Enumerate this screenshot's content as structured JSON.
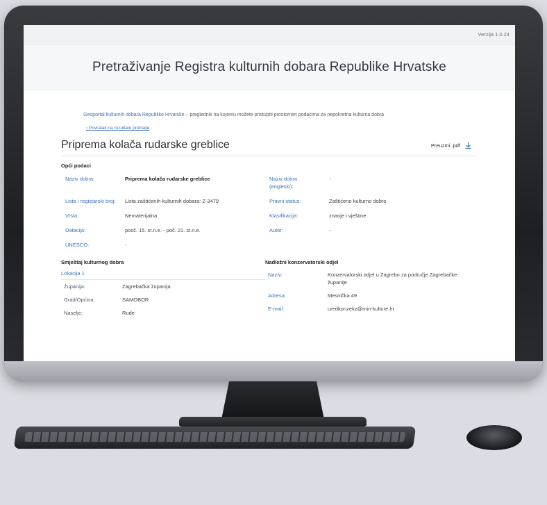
{
  "app": {
    "version": "Verzija 1.0.24",
    "title": "Pretraživanje Registra kulturnih dobara Republike Hrvatske"
  },
  "intro": {
    "link_text": "Geoportal kulturnih dobara Republike Hrvatske",
    "text": " – preglednik na kojemu možete pristupiti prostornim podacima za nepokretna kulturna dobra",
    "back_link": "‹ Povratak na rezultate pretrage"
  },
  "record": {
    "title": "Priprema kolača rudarske greblice",
    "pdf_label": "Preuzmi .pdf",
    "section_general": "Opći podaci",
    "fields": {
      "naziv_label": "Naziv dobra:",
      "naziv_value": "Priprema kolača rudarske greblice",
      "naziv_en_label": "Naziv dobra (engleski):",
      "naziv_en_value": "-",
      "lista_label": "Lista i registarski broj:",
      "lista_value": "Lista zaštićenih kulturnih dobara: Z-3479",
      "status_label": "Pravni status:",
      "status_value": "Zaštićeno kulturno dobro",
      "vrsta_label": "Vrsta:",
      "vrsta_value": "Nematerijalna",
      "klasifikacija_label": "Klasifikacija:",
      "klasifikacija_value": "znanje i vještine",
      "datacija_label": "Datacija:",
      "datacija_value": "pocč. 15. st.n.e. - poč. 21. st.n.e.",
      "autor_label": "Autor:",
      "autor_value": "-",
      "unesco_label": "UNESCO:",
      "unesco_value": "-"
    },
    "section_location": "Smještaj kulturnog dobra",
    "location_link": "Lokacija 1",
    "location": {
      "zupanija_label": "Županija:",
      "zupanija_value": "Zagrebačka županija",
      "grad_label": "Grad/Općina:",
      "grad_value": "SAMOBOR",
      "naselje_label": "Naselje:",
      "naselje_value": "Rude"
    },
    "section_office": "Nadležni konzervatorski odjel",
    "office": {
      "naziv_label": "Naziv:",
      "naziv_value": "Konzervatorski odjel u Zagrebu za područje Zagrebačke županije",
      "adresa_label": "Adresa:",
      "adresa_value": "Mesnička 49",
      "email_label": "E-mail:",
      "email_value": "uredkonzekz@min-kulture.hr"
    }
  }
}
